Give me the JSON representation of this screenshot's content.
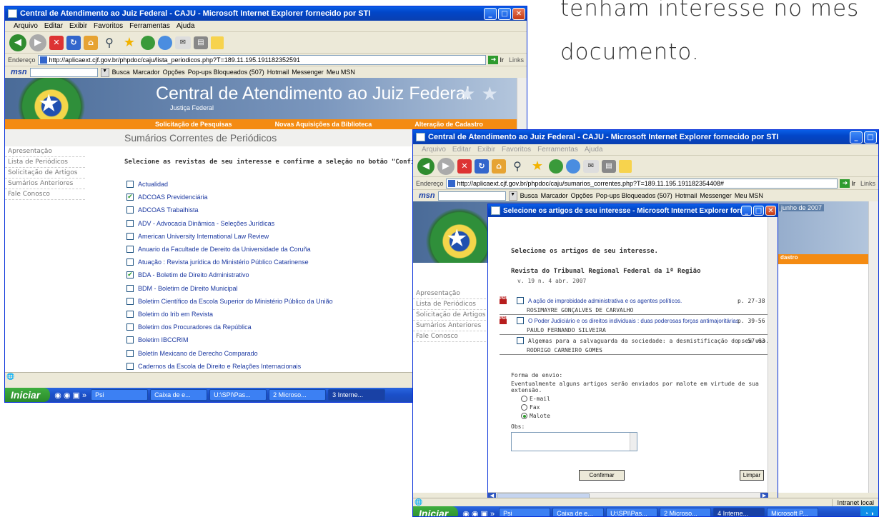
{
  "slide": {
    "line1": "tenham interesse no mes",
    "line2": "documento."
  },
  "window1": {
    "title": "Central de Atendimento ao Juiz Federal - CAJU - Microsoft Internet Explorer fornecido por STI",
    "menu": [
      "Arquivo",
      "Editar",
      "Exibir",
      "Favoritos",
      "Ferramentas",
      "Ajuda"
    ],
    "address_label": "Endereço",
    "url": "http://aplicaext.cjf.gov.br/phpdoc/caju/lista_periodicos.php?T=189.11.195.191182352591",
    "go_label": "Ir",
    "links_label": "Links",
    "msn_bar": {
      "logo": "msn",
      "busca": "Busca",
      "marcador": "Marcador",
      "opcoes": "Opções",
      "popups": "Pop-ups Bloqueados (507)",
      "hotmail": "Hotmail",
      "messenger": "Messenger",
      "meu_msn": "Meu MSN"
    },
    "site_title": "Central de Atendimento ao Juiz Federal",
    "site_subtitle": "Justiça Federal",
    "nav": [
      "Solicitação de Pesquisas",
      "Novas Aquisições da Biblioteca",
      "Alteração de Cadastro"
    ],
    "page_heading": "Sumários Correntes de Periódicos",
    "side_menu": [
      "Apresentação",
      "Lista de Periódicos",
      "Solicitação de Artigos",
      "Sumários Anteriores",
      "Fale Conosco"
    ],
    "instruction": "Selecione as revistas de seu interesse e confirme a seleção no botão \"Confirmar\" ao f",
    "journals": [
      {
        "name": "Actualidad",
        "checked": false
      },
      {
        "name": "ADCOAS Previdenciária",
        "checked": true
      },
      {
        "name": "ADCOAS Trabalhista",
        "checked": false
      },
      {
        "name": "ADV - Advocacia Dinâmica - Seleções Jurídicas",
        "checked": false
      },
      {
        "name": "American University International Law Review",
        "checked": false
      },
      {
        "name": "Anuario da Facultade de Dereito da Universidade da Coruña",
        "checked": false
      },
      {
        "name": "Atuação : Revista jurídica do Ministério Público Catarinense",
        "checked": false
      },
      {
        "name": "BDA - Boletim de Direito Administrativo",
        "checked": true
      },
      {
        "name": "BDM - Boletim de Direito Municipal",
        "checked": false
      },
      {
        "name": "Boletim Científico da Escola Superior do Ministério Público da União",
        "checked": false
      },
      {
        "name": "Boletim do Irib em Revista",
        "checked": false
      },
      {
        "name": "Boletim dos Procuradores da República",
        "checked": false
      },
      {
        "name": "Boletim IBCCRIM",
        "checked": false
      },
      {
        "name": "Boletín Mexicano de Derecho Comparado",
        "checked": false
      },
      {
        "name": "Cadernos da Escola de Direito e Relações Internacionais",
        "checked": false
      }
    ],
    "taskbar": {
      "start": "Iniciar",
      "items": [
        "Psi",
        "Caixa de e...",
        "U:\\SPI\\Pas...",
        "2 Microso...",
        "3 Interne..."
      ]
    }
  },
  "window2": {
    "title": "Central de Atendimento ao Juiz Federal - CAJU - Microsoft Internet Explorer fornecido por STI",
    "menu": [
      "Arquivo",
      "Editar",
      "Exibir",
      "Favoritos",
      "Ferramentas",
      "Ajuda"
    ],
    "address_label": "Endereço",
    "url": "http://aplicaext.cjf.gov.br/phpdoc/caju/sumarios_correntes.php?T=189.11.195.191182354408#",
    "go_label": "Ir",
    "links_label": "Links",
    "date_fragment": "junho de 2007",
    "nav_fragment": "dastro",
    "side_menu": [
      "Apresentação",
      "Lista de Periódicos",
      "Solicitação de Artigos",
      "Sumários Anteriores",
      "Fale Conosco"
    ],
    "status": "Intranet local",
    "taskbar": {
      "start": "Iniciar",
      "items": [
        "Psi",
        "Caixa de e...",
        "U:\\SPI\\Pas...",
        "2 Microso...",
        "4 Interne...",
        "Microsoft P..."
      ]
    }
  },
  "popup": {
    "title": "Selecione os artigos de seu interesse - Microsoft Internet Explorer fornecido por STI",
    "heading": "Selecione os artigos de seu interesse.",
    "journal": "Revista do Tribunal Regional Federal da 1ª Região",
    "volume": "v. 19 n. 4 abr. 2007",
    "articles": [
      {
        "title": "A ação de improbidade administrativa e os agentes políticos.",
        "pages": "p. 27-38",
        "author": "ROSIMAYRE GONÇALVES DE CARVALHO",
        "pdf": true
      },
      {
        "title": "O Poder Judiciário e os direitos individuais : duas poderosas forças antimajoritárias.",
        "pages": "p. 39-56",
        "author": "PAULO FERNANDO SILVEIRA",
        "pdf": true
      },
      {
        "title": "Algemas para a salvaguarda da sociedade: a desmistificação do seu uso.",
        "pages": "p. 57-63",
        "author": "RODRIGO CARNEIRO GOMES",
        "pdf": false
      }
    ],
    "send_label": "Forma de envio:",
    "send_note": "Eventualmente alguns artigos serão enviados por malote em virtude de sua extensão.",
    "options": [
      {
        "label": "E-mail",
        "selected": false
      },
      {
        "label": "Fax",
        "selected": false
      },
      {
        "label": "Malote",
        "selected": true
      }
    ],
    "obs_label": "Obs:",
    "confirm_label": "Confirmar",
    "clear_label": "Limpar"
  }
}
